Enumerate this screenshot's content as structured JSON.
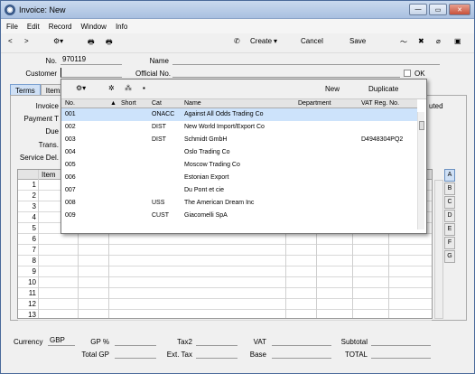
{
  "window": {
    "title": "Invoice: New"
  },
  "menu": [
    "File",
    "Edit",
    "Record",
    "Window",
    "Info"
  ],
  "toolbar": {
    "create": "Create",
    "cancel": "Cancel",
    "save": "Save"
  },
  "header": {
    "no_label": "No.",
    "no_value": "970119",
    "name_label": "Name",
    "name_value": "",
    "customer_label": "Customer",
    "customer_value": "",
    "official_label": "Official No.",
    "official_value": "",
    "ok_label": "OK"
  },
  "tabs": [
    "Terms",
    "Items"
  ],
  "panel_labels": {
    "invoice": "Invoice",
    "payment": "Payment T",
    "due": "Due",
    "trans": "Trans.",
    "service": "Service Del.",
    "uted": "uted"
  },
  "grid": {
    "column_item": "Item",
    "rows": [
      "1",
      "2",
      "3",
      "4",
      "5",
      "6",
      "7",
      "8",
      "9",
      "10",
      "11",
      "12",
      "13"
    ]
  },
  "side_letters": [
    "A",
    "B",
    "C",
    "D",
    "E",
    "F",
    "G"
  ],
  "totals": {
    "currency_label": "Currency",
    "currency_value": "GBP",
    "gp_pct": "GP %",
    "total_gp": "Total GP",
    "tax2": "Tax2",
    "ext_tax": "Ext. Tax",
    "vat": "VAT",
    "base": "Base",
    "subtotal": "Subtotal",
    "total": "TOTAL"
  },
  "popup": {
    "new": "New",
    "duplicate": "Duplicate",
    "columns": [
      "No.",
      "Short",
      "Cat",
      "Name",
      "Department",
      "VAT Reg. No."
    ],
    "rows": [
      {
        "no": "001",
        "short": "",
        "cat": "ONACC",
        "name": "Against All Odds Trading Co",
        "dept": "",
        "vat": ""
      },
      {
        "no": "002",
        "short": "",
        "cat": "DIST",
        "name": "New World Import/Export Co",
        "dept": "",
        "vat": ""
      },
      {
        "no": "003",
        "short": "",
        "cat": "DIST",
        "name": "Schmidt GmbH",
        "dept": "",
        "vat": "D4948304PQ2"
      },
      {
        "no": "004",
        "short": "",
        "cat": "",
        "name": "Oslo Trading Co",
        "dept": "",
        "vat": ""
      },
      {
        "no": "005",
        "short": "",
        "cat": "",
        "name": "Moscow Trading Co",
        "dept": "",
        "vat": ""
      },
      {
        "no": "006",
        "short": "",
        "cat": "",
        "name": "Estonian Export",
        "dept": "",
        "vat": ""
      },
      {
        "no": "007",
        "short": "",
        "cat": "",
        "name": "Du Pont et cie",
        "dept": "",
        "vat": ""
      },
      {
        "no": "008",
        "short": "",
        "cat": "USS",
        "name": "The American Dream Inc",
        "dept": "",
        "vat": ""
      },
      {
        "no": "009",
        "short": "",
        "cat": "CUST",
        "name": "Giacomelli SpA",
        "dept": "",
        "vat": ""
      }
    ]
  }
}
